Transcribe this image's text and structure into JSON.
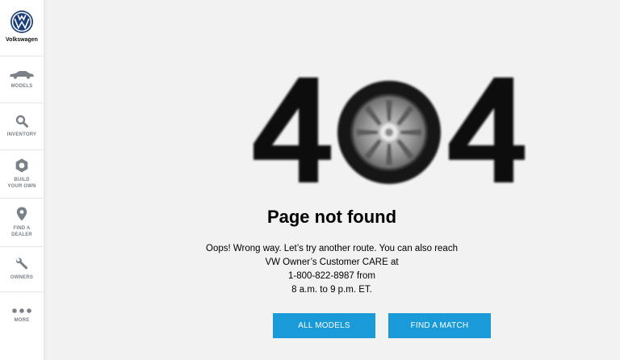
{
  "sidebar": {
    "brand": "Volkswagen",
    "items": [
      {
        "label": "MODELS",
        "icon": "car-icon"
      },
      {
        "label": "INVENTORY",
        "icon": "search-icon"
      },
      {
        "label": "BUILD\nYOUR OWN",
        "icon": "hexagon-nut-icon"
      },
      {
        "label": "FIND A\nDEALER",
        "icon": "map-pin-icon"
      },
      {
        "label": "OWNERS",
        "icon": "wrench-icon"
      },
      {
        "label": "MORE",
        "icon": "more-dots-icon"
      }
    ]
  },
  "error": {
    "code_graphic": "404",
    "title": "Page not found",
    "message_lines": [
      "Oops! Wrong way. Let’s try another route. You can also reach",
      "VW Owner’s Customer CARE at",
      "1-800-822-8987 from",
      "8 a.m. to 9 p.m. ET."
    ]
  },
  "buttons": {
    "all_models": "ALL MODELS",
    "find_a_match": "FIND A MATCH"
  },
  "colors": {
    "accent": "#1a9ad8",
    "background": "#f2f2f2",
    "sidebar_icon": "#7a8189",
    "brand_blue": "#1b3f7b"
  }
}
